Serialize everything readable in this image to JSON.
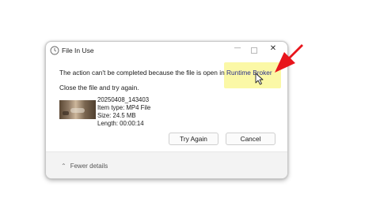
{
  "dialog": {
    "title": "File In Use",
    "message_prefix": "The action can't be completed because the file is open in",
    "process_name": "Runtime Broker",
    "instruction": "Close the file and try again.",
    "file": {
      "name": "20250408_143403",
      "type_line": "Item type: MP4 File",
      "size_line": "Size: 24.5 MB",
      "length_line": "Length: 00:00:14"
    },
    "buttons": {
      "retry": "Try Again",
      "cancel": "Cancel"
    },
    "footer": {
      "fewer_details": "Fewer details"
    },
    "window_controls": {
      "minimize": "—",
      "close": "✕"
    }
  },
  "colors": {
    "highlight": "#fbf8a6",
    "arrow": "#e8151c",
    "process_text": "#2a2f86"
  }
}
